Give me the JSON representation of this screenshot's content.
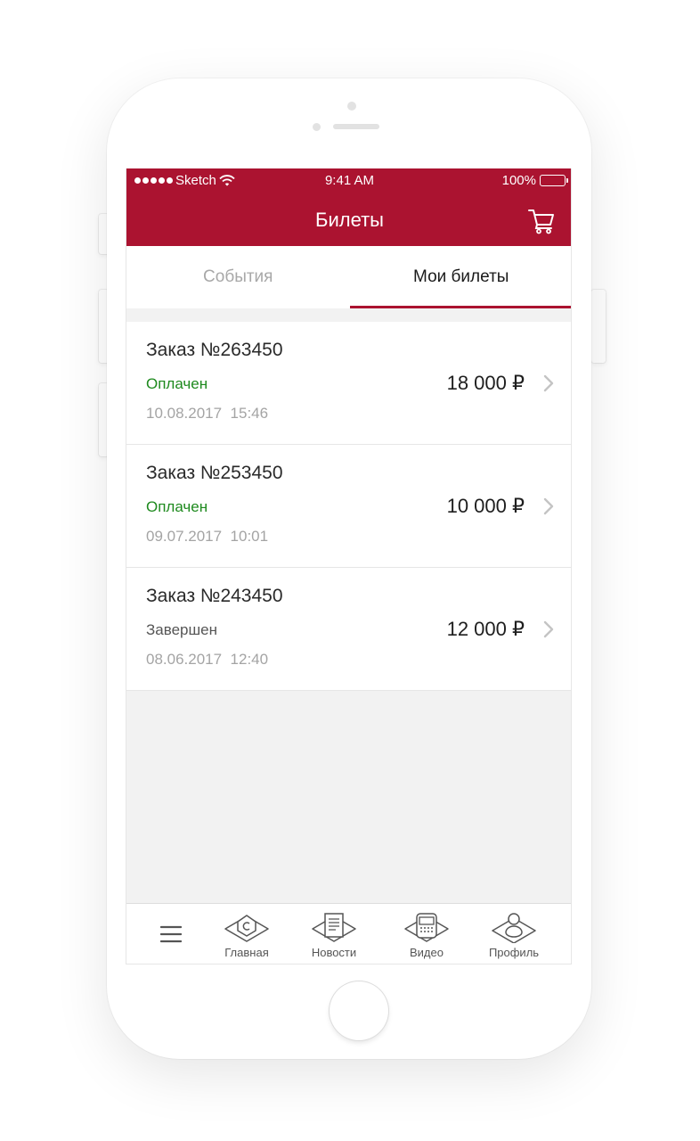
{
  "status_bar": {
    "carrier": "Sketch",
    "time": "9:41 AM",
    "battery": "100%"
  },
  "header": {
    "title": "Билеты",
    "cart_icon": "cart-icon",
    "color": "#ab1330"
  },
  "tabs": [
    {
      "label": "События",
      "active": false
    },
    {
      "label": "Мои билеты",
      "active": true
    }
  ],
  "orders": [
    {
      "title": "Заказ №263450",
      "status": "Оплачен",
      "status_color": "#1e8a1e",
      "date": "10.08.2017",
      "time": "15:46",
      "amount": "18 000 ₽"
    },
    {
      "title": "Заказ №253450",
      "status": "Оплачен",
      "status_color": "#1e8a1e",
      "date": "09.07.2017",
      "time": "10:01",
      "amount": "10 000 ₽"
    },
    {
      "title": "Заказ №243450",
      "status": "Завершен",
      "status_color": "#555555",
      "date": "08.06.2017",
      "time": "12:40",
      "amount": "12 000 ₽"
    }
  ],
  "tabbar": {
    "items": [
      {
        "label": "Главная",
        "icon": "home-icon"
      },
      {
        "label": "Новости",
        "icon": "news-icon"
      },
      {
        "label": "Видео",
        "icon": "video-icon"
      },
      {
        "label": "Профиль",
        "icon": "profile-icon"
      }
    ]
  }
}
